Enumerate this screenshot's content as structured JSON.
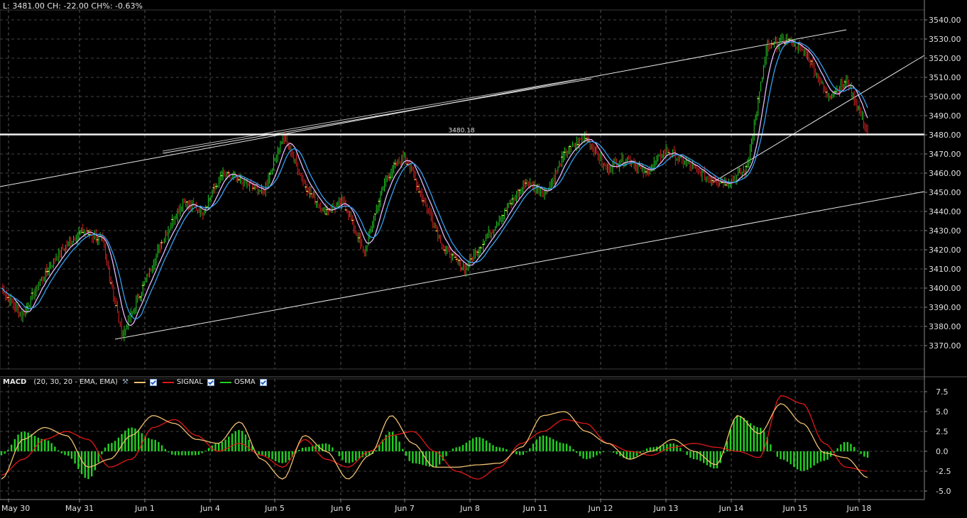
{
  "header": {
    "text": "L: 3481.00 CH: -22.00 CH%: -0.63%"
  },
  "price_axis": {
    "ticks": [
      "3540.00",
      "3530.00",
      "3520.00",
      "3510.00",
      "3500.00",
      "3490.00",
      "3480.00",
      "3470.00",
      "3460.00",
      "3450.00",
      "3440.00",
      "3430.00",
      "3420.00",
      "3410.00",
      "3400.00",
      "3390.00",
      "3380.00",
      "3370.00"
    ]
  },
  "macd_axis": {
    "ticks": [
      "7.5",
      "5.0",
      "2.5",
      "0.0",
      "-2.5",
      "-5.0"
    ]
  },
  "time_axis": {
    "labels": [
      "May 30",
      "May 31",
      "Jun 1",
      "Jun 4",
      "Jun 5",
      "Jun 6",
      "Jun 7",
      "Jun 8",
      "Jun 11",
      "Jun 12",
      "Jun 13",
      "Jun 14",
      "Jun 15",
      "Jun 18"
    ]
  },
  "horizontal_line": {
    "value": 3480.18,
    "label": "3480.18"
  },
  "macd_legend": {
    "title": "MACD",
    "params": "(20, 30, 20 - EMA, EMA)",
    "signal_label": "SIGNAL",
    "osma_label": "OSMA"
  },
  "colors": {
    "macd_line": "#f0c070",
    "signal_line": "#e01818",
    "osma": "#22d022",
    "candle_up": "#22cc22",
    "candle_down": "#dd2222",
    "ma_fast": "#e8b8ff",
    "ma_slow": "#33a0f0"
  },
  "chart_data": [
    {
      "type": "line",
      "title": "",
      "panel": "price",
      "ylim": [
        3360,
        3545
      ],
      "grid": true,
      "x": [
        "May 30",
        "May 31",
        "Jun 1",
        "Jun 4",
        "Jun 5",
        "Jun 6",
        "Jun 7",
        "Jun 8",
        "Jun 11",
        "Jun 12",
        "Jun 13",
        "Jun 14",
        "Jun 15",
        "Jun 18"
      ],
      "price_path": [
        3400,
        3385,
        3405,
        3420,
        3430,
        3425,
        3375,
        3400,
        3425,
        3445,
        3440,
        3460,
        3455,
        3450,
        3480,
        3455,
        3440,
        3445,
        3418,
        3455,
        3470,
        3445,
        3420,
        3410,
        3425,
        3440,
        3455,
        3450,
        3470,
        3480,
        3462,
        3468,
        3460,
        3472,
        3465,
        3458,
        3455,
        3462,
        3525,
        3530,
        3522,
        3500,
        3508,
        3481
      ],
      "horizontal_line": 3480.18,
      "trendlines": [
        {
          "name": "upper channel",
          "from": [
            "May 30",
            3453
          ],
          "to": [
            "Jun 18",
            3537
          ]
        },
        {
          "name": "lower channel",
          "from": [
            "May 31",
            3373
          ],
          "to": [
            "Jun 18",
            3447
          ]
        },
        {
          "name": "fan line",
          "from": [
            "Jun 4",
            3470
          ],
          "to": [
            "Jun 11",
            3509
          ]
        },
        {
          "name": "short support",
          "from": [
            "Jun 14",
            3456
          ],
          "to": [
            "Jun 18",
            3520
          ]
        }
      ]
    },
    {
      "type": "line",
      "panel": "MACD",
      "ylim": [
        -6,
        9
      ],
      "series": [
        {
          "name": "SIGNAL",
          "values": [
            -3,
            -1,
            1.5,
            2.5,
            1.5,
            -2,
            -1,
            3,
            4,
            2,
            0,
            1,
            -0.5,
            -2,
            1.5,
            -1,
            -2,
            0,
            2,
            2.5,
            0,
            -2.5,
            -3.5,
            -2,
            1,
            2.5,
            4,
            3.5,
            1,
            0,
            -0.5,
            0.5,
            1,
            0.5,
            0,
            -0.8,
            7,
            6,
            1,
            -2,
            -2.5
          ]
        },
        {
          "name": "OSMA",
          "values": [
            -0.5,
            2.5,
            1.5,
            -0.5,
            -3.5,
            1,
            3,
            1.5,
            -0.5,
            -0.5,
            1,
            2.7,
            -0.5,
            -1.5,
            0.5,
            1,
            -1.5,
            -0.5,
            2.5,
            -1.5,
            -2,
            0.5,
            1.8,
            0.5,
            -0.5,
            2,
            1,
            -1,
            0,
            -1,
            0.5,
            1,
            -1,
            -2.2,
            4.5,
            3,
            -1,
            -2.5,
            -1.2,
            1.2,
            -0.8
          ]
        }
      ],
      "grid": true
    }
  ]
}
